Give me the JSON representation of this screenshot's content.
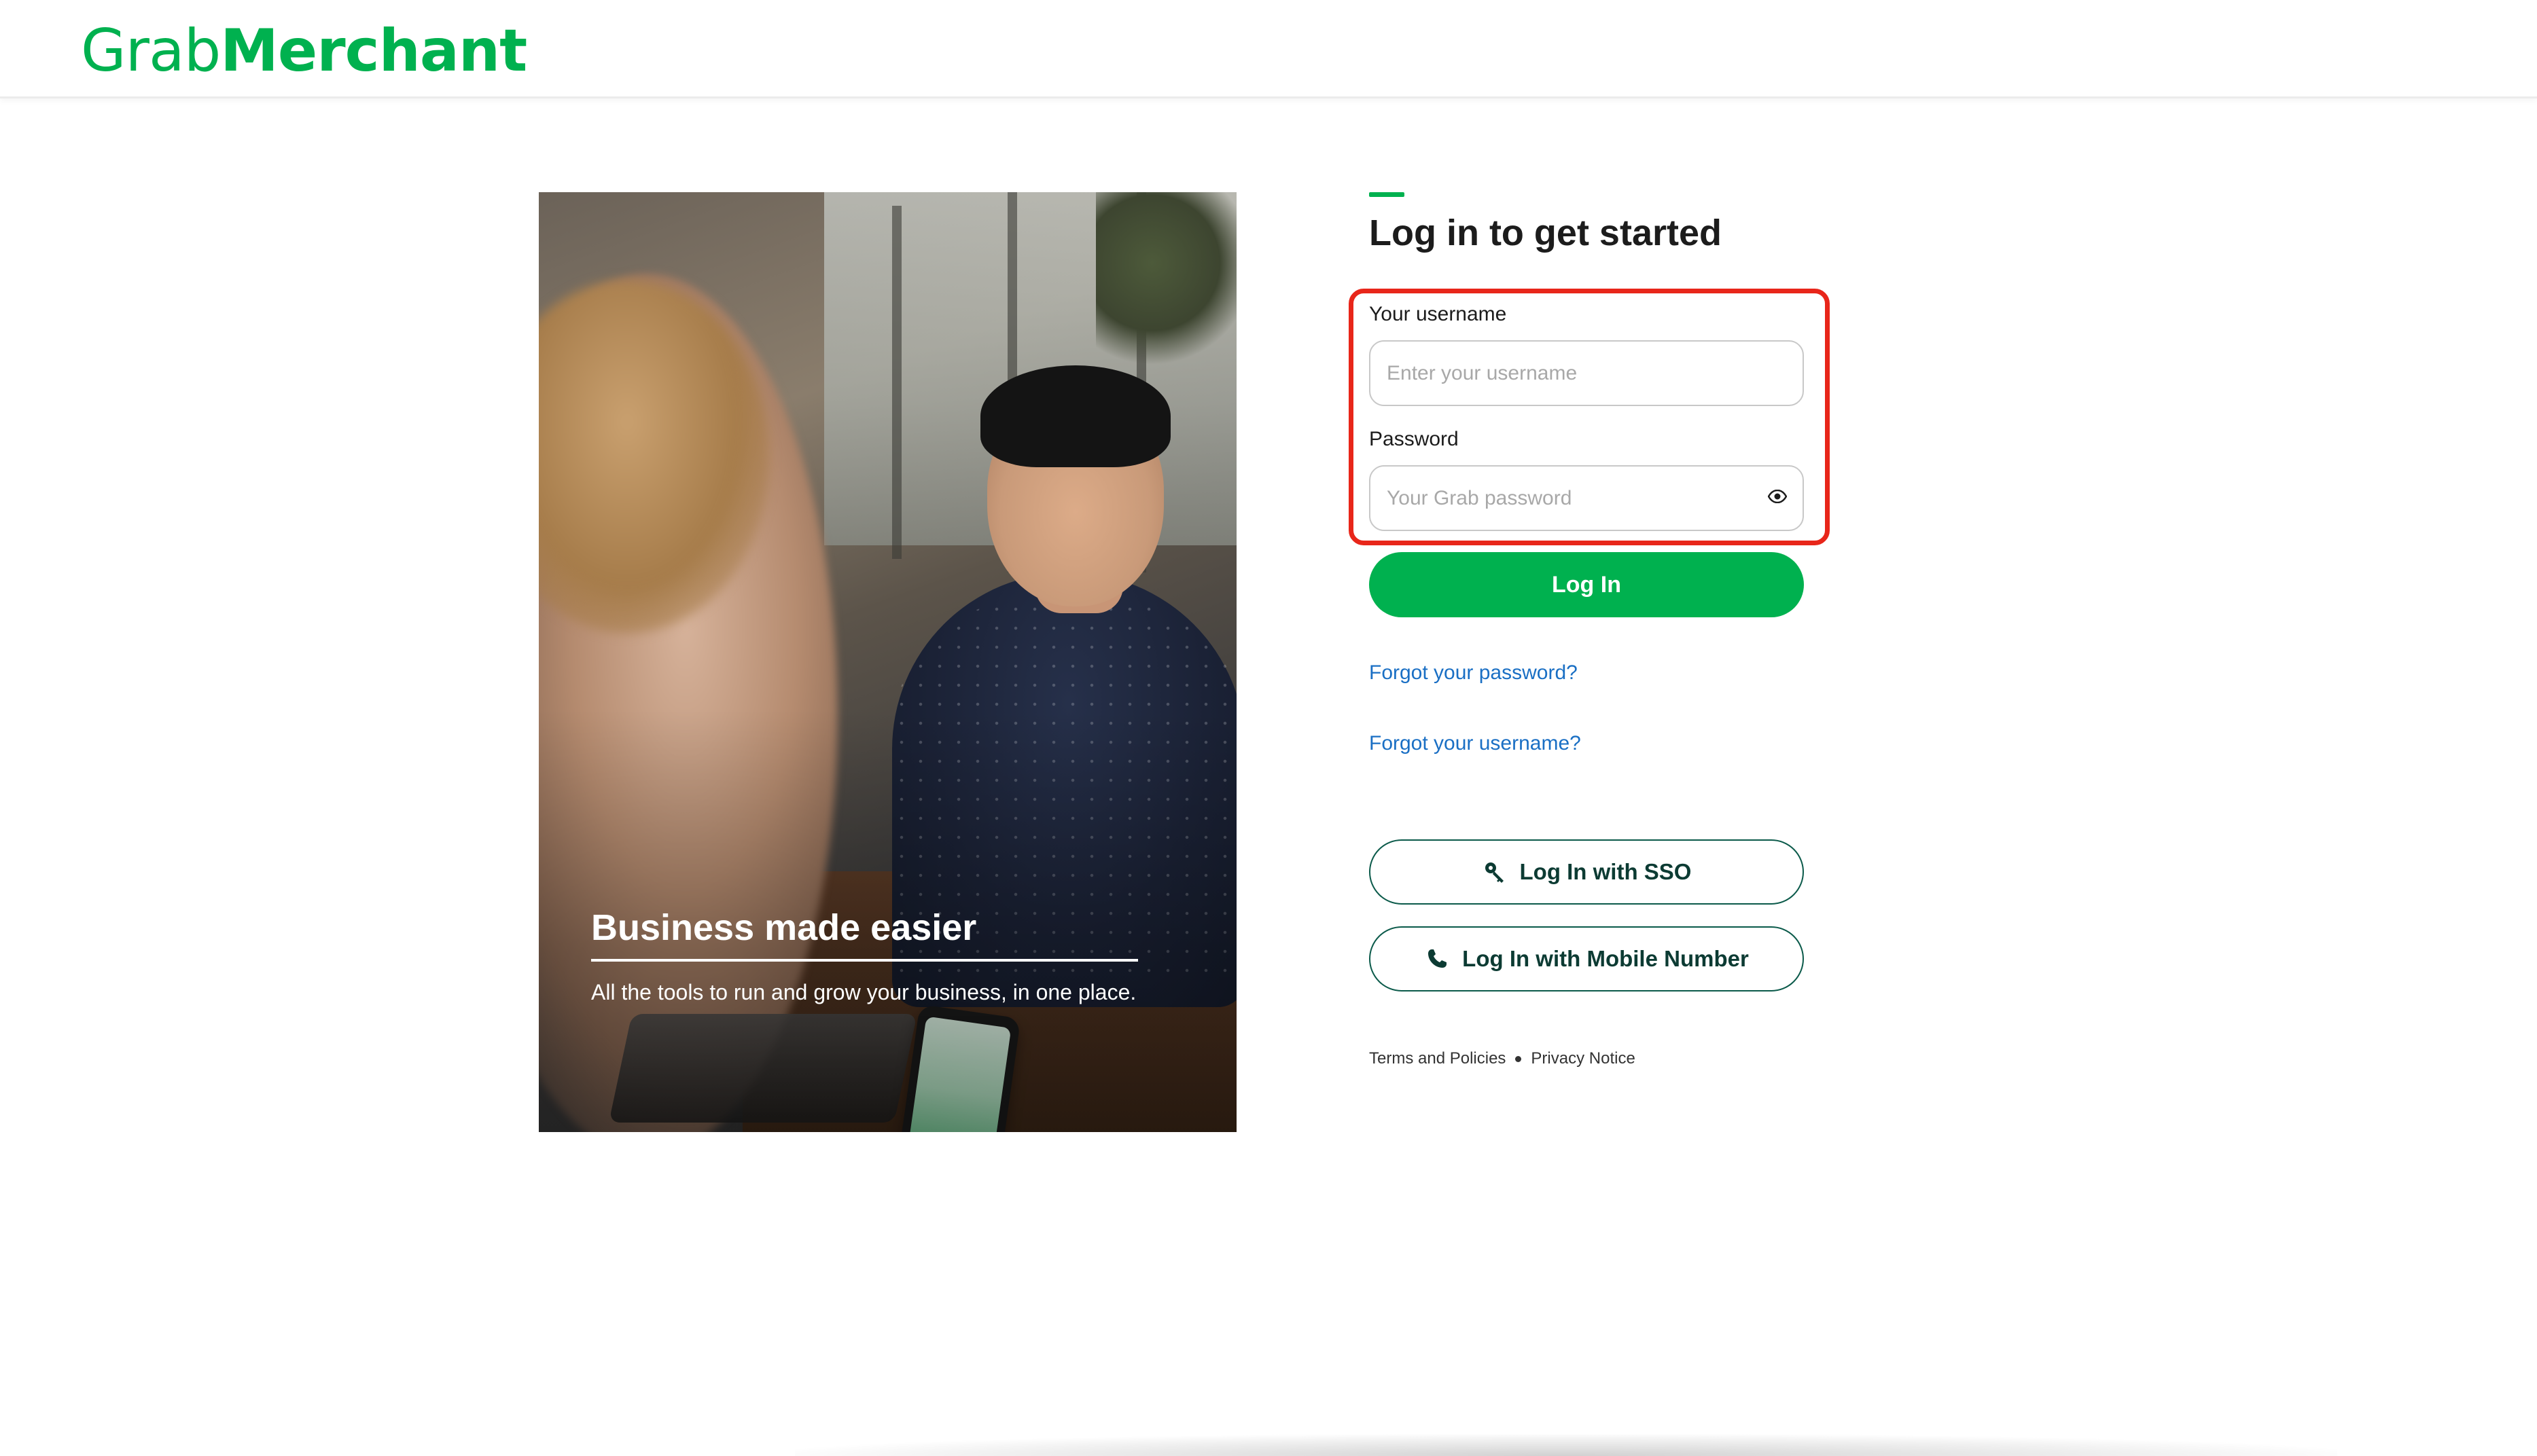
{
  "brand": {
    "logo_part1": "Grab",
    "logo_part2": "Merchant",
    "color": "#00b14f"
  },
  "hero": {
    "title": "Business made easier",
    "subtitle": "All the tools to run and grow your business, in one place."
  },
  "login": {
    "title": "Log in to get started",
    "username_label": "Your username",
    "username_placeholder": "Enter your username",
    "username_value": "",
    "password_label": "Password",
    "password_placeholder": "Your Grab password",
    "password_value": "",
    "show_password_icon": "eye-icon",
    "submit_label": "Log In",
    "forgot_password": "Forgot your password?",
    "forgot_username": "Forgot your username?",
    "sso_label": "Log In with SSO",
    "sso_icon": "key-icon",
    "mobile_label": "Log In with Mobile Number",
    "mobile_icon": "phone-icon",
    "highlight_color": "#e8261a"
  },
  "footer": {
    "terms": "Terms and Policies",
    "privacy": "Privacy Notice"
  },
  "colors": {
    "primary": "#00b14f",
    "link": "#1a6fc4",
    "outline_button": "#0b5a4a"
  }
}
